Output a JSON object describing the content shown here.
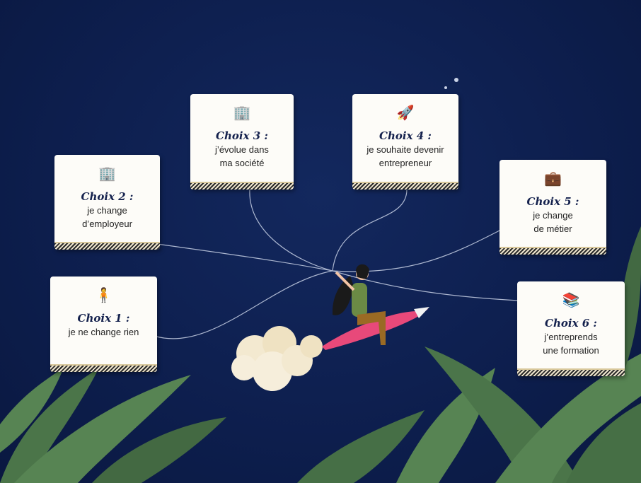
{
  "choices": [
    {
      "title": "Choix 1 :",
      "line1": "je ne change rien",
      "line2": "",
      "icon": "person-arrows-icon"
    },
    {
      "title": "Choix 2 :",
      "line1": "je change",
      "line2": "d’employeur",
      "icon": "buildings-transfer-icon"
    },
    {
      "title": "Choix 3 :",
      "line1": "j’évolue dans",
      "line2": "ma société",
      "icon": "building-briefcase-icon"
    },
    {
      "title": "Choix 4 :",
      "line1": "je souhaite devenir",
      "line2": "entrepreneur",
      "icon": "rocket-icon"
    },
    {
      "title": "Choix 5 :",
      "line1": "je change",
      "line2": "de métier",
      "icon": "briefcase-wand-icon"
    },
    {
      "title": "Choix 6 :",
      "line1": "j’entreprends",
      "line2": "une formation",
      "icon": "books-graduation-icon"
    }
  ],
  "colors": {
    "background": "#0d1e4d",
    "title": "#14214d",
    "pen": "#e8497a",
    "leaf": "#4f7a4a"
  }
}
